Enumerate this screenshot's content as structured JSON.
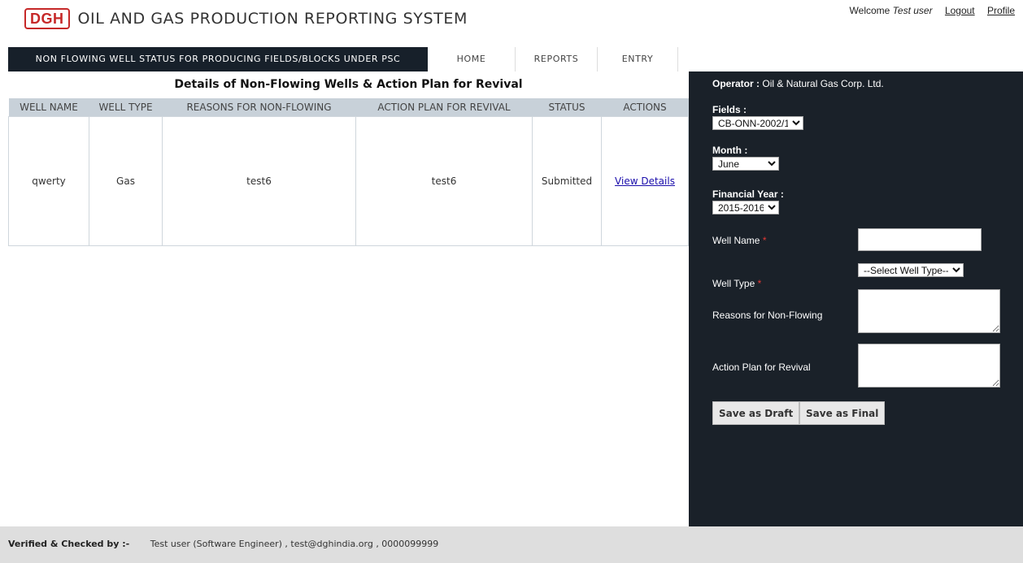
{
  "header": {
    "logo_text": "DGH",
    "app_title": "OIL AND GAS PRODUCTION REPORTING SYSTEM",
    "welcome_prefix": "Welcome",
    "user_name": "Test user",
    "logout_label": "Logout",
    "profile_label": "Profile"
  },
  "nav": {
    "active_title": "NON FLOWING WELL STATUS FOR PRODUCING FIELDS/BLOCKS UNDER PSC",
    "items": [
      "HOME",
      "REPORTS",
      "ENTRY"
    ]
  },
  "table": {
    "title": "Details of Non-Flowing Wells & Action Plan for Revival",
    "columns": [
      "WELL NAME",
      "WELL TYPE",
      "REASONS FOR NON-FLOWING",
      "ACTION PLAN FOR REVIVAL",
      "STATUS",
      "ACTIONS"
    ],
    "rows": [
      {
        "well_name": "qwerty",
        "well_type": "Gas",
        "reasons": "test6",
        "action_plan": "test6",
        "status": "Submitted",
        "action_link": "View Details"
      }
    ]
  },
  "panel": {
    "operator_label": "Operator :",
    "operator_value": "Oil & Natural Gas Corp. Ltd.",
    "fields_label": "Fields :",
    "fields_value": "CB-ONN-2002/1",
    "month_label": "Month :",
    "month_value": "June",
    "fy_label": "Financial Year :",
    "fy_value": "2015-2016",
    "well_name_label": "Well Name",
    "well_name_value": "",
    "well_type_label": "Well Type",
    "well_type_value": "--Select Well Type--",
    "reasons_label": "Reasons for Non-Flowing",
    "reasons_value": "",
    "action_label": "Action Plan for Revival",
    "action_value": "",
    "required_mark": "*",
    "save_draft_label": "Save as Draft",
    "save_final_label": "Save as Final"
  },
  "footer": {
    "verified_label": "Verified & Checked by :-",
    "verified_value": "Test user (Software Engineer) , test@dghindia.org , 0000099999"
  },
  "colors": {
    "nav_active_bg": "#17202a",
    "panel_bg": "#1a2129",
    "table_header_bg": "#c8d1d9",
    "logo_red": "#c62828",
    "footer_bg": "#dedede",
    "required_red": "#e53935"
  }
}
